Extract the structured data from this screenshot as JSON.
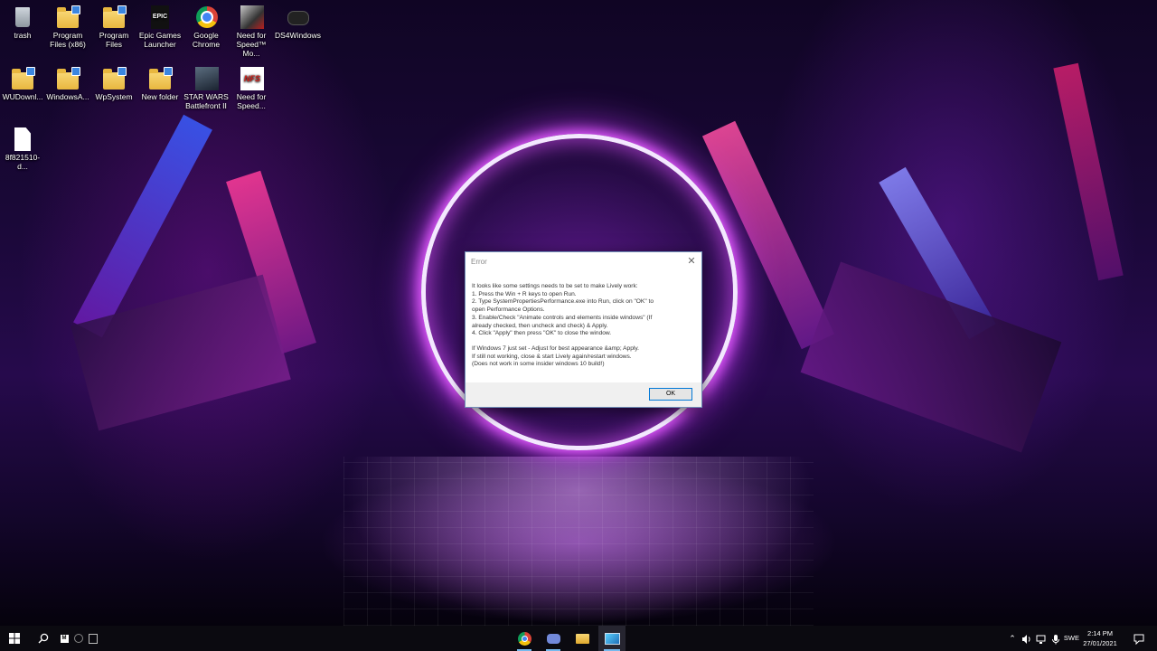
{
  "desktop_icons": [
    {
      "label": "trash",
      "kind": "trash",
      "icon": "recycle-bin-icon"
    },
    {
      "label": "Program Files (x86)",
      "kind": "folder",
      "icon": "folder-shortcut-icon"
    },
    {
      "label": "Program Files",
      "kind": "folder",
      "icon": "folder-shortcut-icon"
    },
    {
      "label": "Epic Games Launcher",
      "kind": "epic",
      "icon": "epic-games-icon"
    },
    {
      "label": "Google Chrome",
      "kind": "chrome",
      "icon": "chrome-icon"
    },
    {
      "label": "Need for Speed™ Mo...",
      "kind": "nfs",
      "icon": "nfs-most-wanted-icon"
    },
    {
      "label": "DS4Windows",
      "kind": "ds4",
      "icon": "gamepad-icon"
    },
    {
      "label": "WUDownl...",
      "kind": "folder",
      "icon": "folder-shortcut-icon"
    },
    {
      "label": "WindowsA...",
      "kind": "folder",
      "icon": "folder-shortcut-icon"
    },
    {
      "label": "WpSystem",
      "kind": "folder",
      "icon": "folder-shortcut-icon"
    },
    {
      "label": "New folder",
      "kind": "folder",
      "icon": "folder-icon"
    },
    {
      "label": "STAR WARS Battlefront II",
      "kind": "starwars",
      "icon": "star-wars-battlefront-icon"
    },
    {
      "label": "Need for Speed...",
      "kind": "nfs2",
      "icon": "nfs-icon"
    },
    {
      "label": "8f821510-d...",
      "kind": "file",
      "icon": "file-icon"
    }
  ],
  "dialog": {
    "title": "Error",
    "close_glyph": "✕",
    "lines": [
      "It looks like some settings needs to be set to make Lively work:",
      "1. Press the Win + R keys to open Run.",
      "2. Type SystemPropertiesPerformance.exe into Run, click on \"OK\" to",
      "open Performance Options.",
      "3. Enable/Check \"Animate controls and elements inside windows\" (If",
      "already checked, then uncheck and check) & Apply.",
      "4. Click \"Apply\" then press \"OK\" to close the window."
    ],
    "lines2": [
      "If Windows 7 just set - Adjust for best appearance &amp; Apply.",
      "If still not working, close & start Lively again/restart windows.",
      "(Does not work in some insider windows 10 build!)"
    ],
    "ok_label": "OK"
  },
  "taskbar": {
    "start_icon": "windows-start-icon",
    "search_icon": "search-icon",
    "pinned": [
      "chrome-icon",
      "discord-icon",
      "file-explorer-icon",
      "lively-wallpaper-icon"
    ],
    "tray": {
      "language": "SWE",
      "time": "2:14 PM",
      "date": "27/01/2021"
    }
  },
  "colors": {
    "ring_glow": "#e55bff",
    "accent": "#0078d7",
    "taskbar": "#0b0a10"
  }
}
